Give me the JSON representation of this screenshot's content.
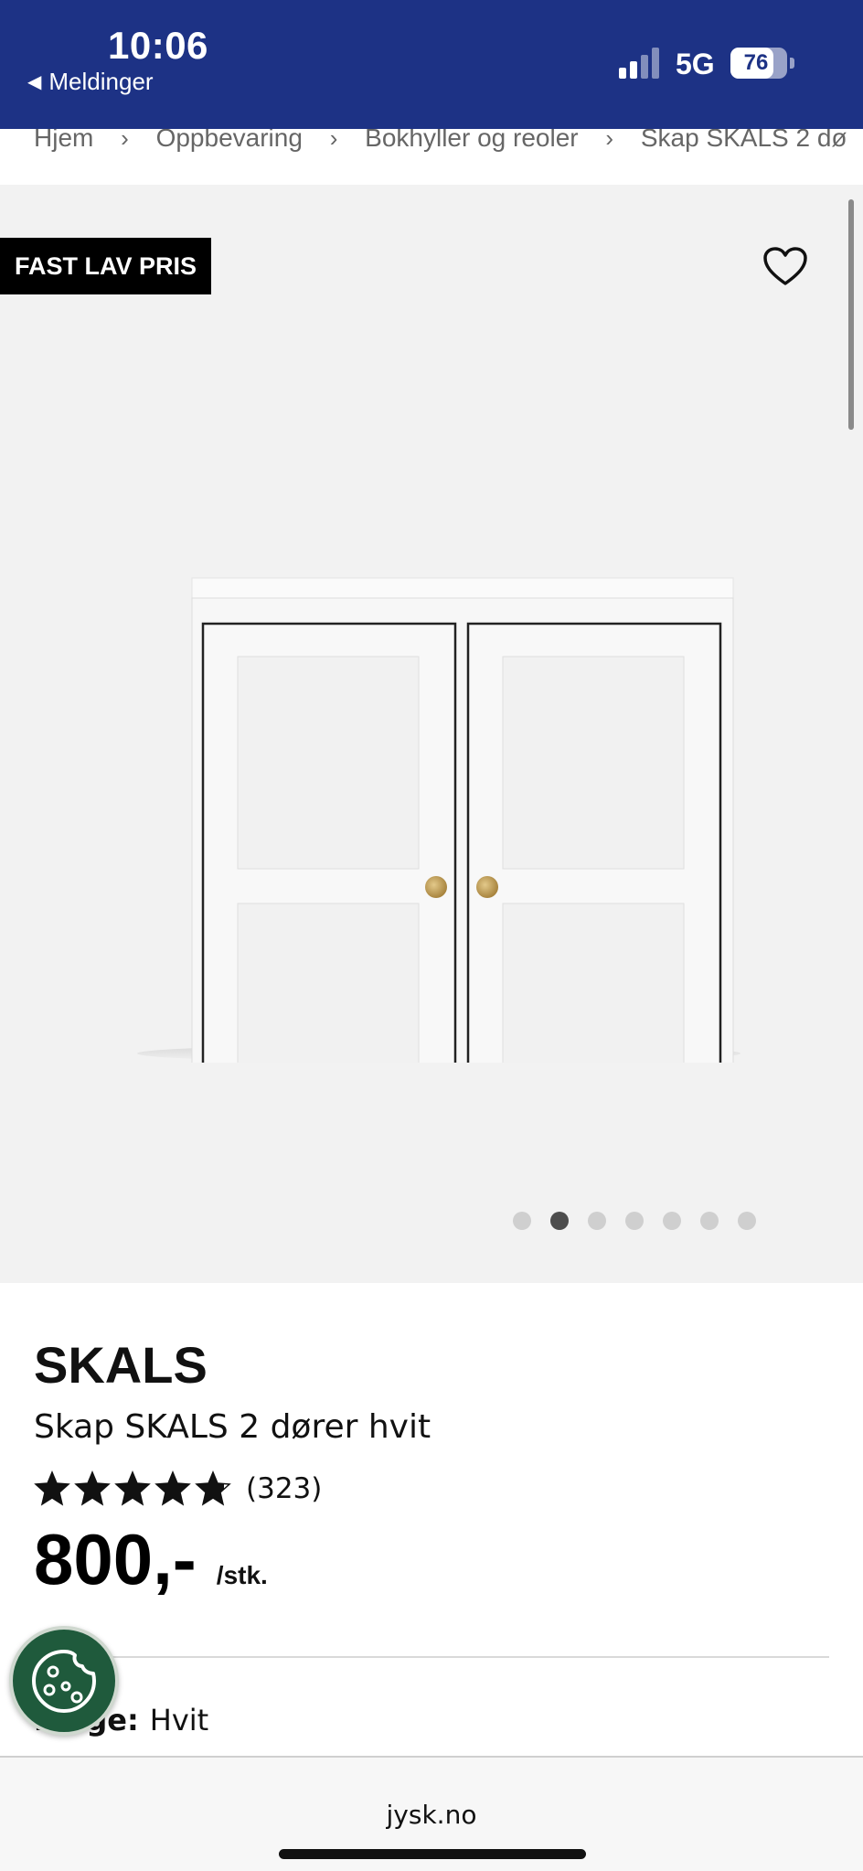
{
  "status_bar": {
    "time": "10:06",
    "back_app": "Meldinger",
    "network": "5G",
    "battery": "76",
    "battery_level": 0.76,
    "background_color": "#1d3285"
  },
  "breadcrumb": {
    "items": [
      "Hjem",
      "Oppbevaring",
      "Bokhyller og reoler",
      "Skap SKALS 2 dø"
    ]
  },
  "gallery": {
    "badge": "FAST LAV PRIS",
    "favorite_icon": "heart-outline-icon",
    "image_count": 7,
    "active_index": 1
  },
  "product": {
    "brand": "SKALS",
    "name": "Skap SKALS 2 dører hvit",
    "rating": 4.8,
    "review_count": "(323)",
    "price": "800,-",
    "unit": "/stk.",
    "color_label": "Farge:",
    "color_value": "Hvit"
  },
  "cookie_button": {
    "icon": "cookie-icon",
    "color": "#1f5a3c"
  },
  "browser": {
    "url": "jysk.no"
  }
}
